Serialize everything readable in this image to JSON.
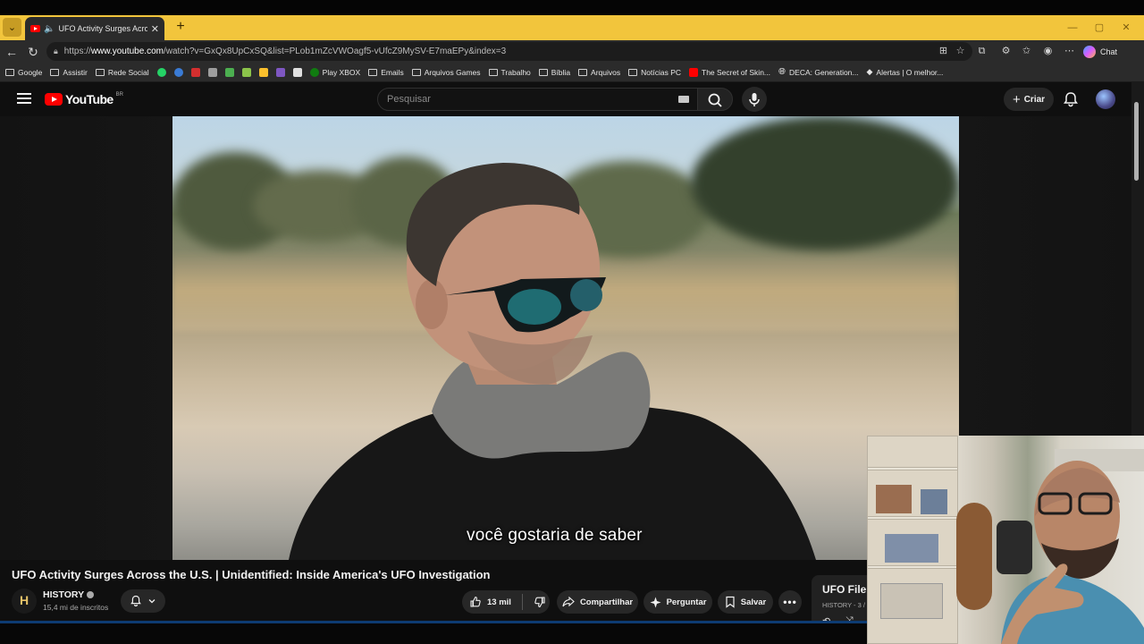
{
  "browser": {
    "tab_title": "UFO Activity Surges Across the U.S.",
    "url_prefix": "https://",
    "url_domain": "www.youtube.com",
    "url_rest": "/watch?v=GxQx8UpCxSQ&list=PLob1mZcVWOagf5-vUfcZ9MySV-E7maEPy&index=3",
    "chat_label": "Chat"
  },
  "bookmarks": [
    {
      "label": "Google",
      "icon": "folder-icon"
    },
    {
      "label": "Assistir",
      "icon": "folder-icon"
    },
    {
      "label": "Rede Social",
      "icon": "folder-icon"
    },
    {
      "label": "",
      "icon": "whatsapp-icon",
      "color": "#25d366"
    },
    {
      "label": "",
      "icon": "globe-blue-icon",
      "color": "#3a7bd5"
    },
    {
      "label": "",
      "icon": "red-app-icon",
      "color": "#d32f2f"
    },
    {
      "label": "",
      "icon": "gray-app-icon",
      "color": "#9e9e9e"
    },
    {
      "label": "",
      "icon": "star-app-icon",
      "color": "#4caf50"
    },
    {
      "label": "",
      "icon": "green-app-icon",
      "color": "#8bc34a"
    },
    {
      "label": "",
      "icon": "yellow-app-icon",
      "color": "#fbc02d"
    },
    {
      "label": "",
      "icon": "purple-app-icon",
      "color": "#7e57c2"
    },
    {
      "label": "",
      "icon": "s-app-icon",
      "color": "#e0e0e0"
    },
    {
      "label": "Play XBOX",
      "icon": "xbox-icon",
      "color": "#107c10"
    },
    {
      "label": "Emails",
      "icon": "folder-icon"
    },
    {
      "label": "Arquivos Games",
      "icon": "folder-icon"
    },
    {
      "label": "Trabalho",
      "icon": "folder-icon"
    },
    {
      "label": "Bíblia",
      "icon": "folder-icon"
    },
    {
      "label": "Arquivos",
      "icon": "folder-icon"
    },
    {
      "label": "Notícias PC",
      "icon": "folder-icon"
    },
    {
      "label": "The Secret of Skin...",
      "icon": "youtube-icon",
      "color": "#ff0000"
    },
    {
      "label": "DECA: Generation...",
      "icon": "globe-icon"
    },
    {
      "label": "Alertas | O melhor...",
      "icon": "alert-icon"
    }
  ],
  "youtube": {
    "logo_text": "YouTube",
    "country_code": "BR",
    "search_placeholder": "Pesquisar",
    "create_label": "Criar"
  },
  "video": {
    "subtitle": "você gostaria de saber",
    "title": "UFO Activity Surges Across the U.S. | Unidentified: Inside America's UFO Investigation",
    "channel_name": "HISTORY",
    "channel_logo": "H",
    "subscribers": "15,4 mi de inscritos",
    "likes": "13 mil",
    "share_label": "Compartilhar",
    "ask_label": "Perguntar",
    "save_label": "Salvar"
  },
  "playlist": {
    "title": "UFO File",
    "subtitle": "HISTORY - 3 /"
  }
}
